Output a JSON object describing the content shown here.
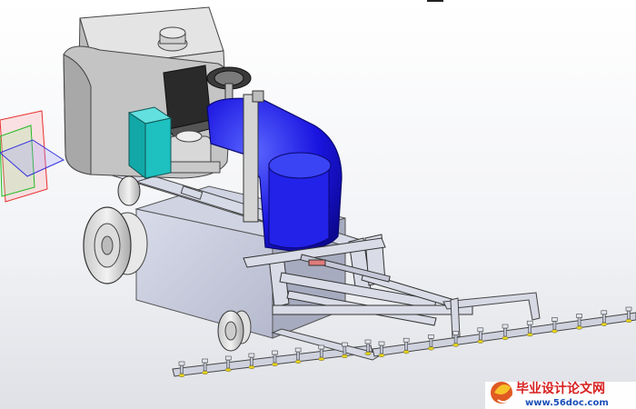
{
  "watermark": {
    "title": "毕业设计论文网",
    "url": "www.56doc.com"
  },
  "colors": {
    "background_top": "#ffffff",
    "background_bottom": "#dfe1e6",
    "hopper_gray": "#cfcfcf",
    "frame_steel": "#c8ccdc",
    "pump_blue": "#1a14e0",
    "motor_dark": "#2a2a2a",
    "teal_part": "#1ec0c0",
    "watermark_red": "#d82020",
    "watermark_blue": "#1b4fb8"
  },
  "icons": [
    "triad-axis-icon",
    "watermark-logo-icon"
  ]
}
